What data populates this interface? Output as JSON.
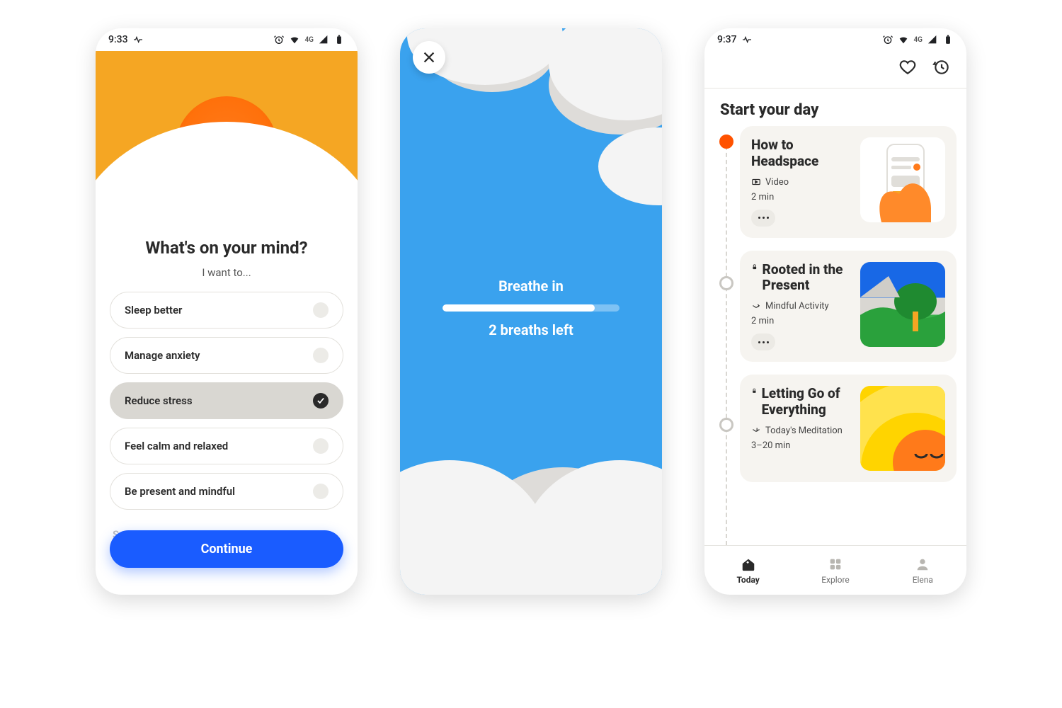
{
  "colors": {
    "accent_orange": "#f5a623",
    "face_orange": "#ff6a00",
    "primary_blue": "#1a5cff",
    "sky_blue": "#3aa2ee",
    "active_red": "#ff5200"
  },
  "screen1": {
    "status": {
      "time": "9:33",
      "network_label": "4G"
    },
    "title": "What's on your mind?",
    "subtitle": "I want to...",
    "options": [
      {
        "label": "Sleep better",
        "selected": false
      },
      {
        "label": "Manage anxiety",
        "selected": false
      },
      {
        "label": "Reduce stress",
        "selected": true
      },
      {
        "label": "Feel calm and relaxed",
        "selected": false
      },
      {
        "label": "Be present and mindful",
        "selected": false
      },
      {
        "label": "Something else",
        "selected": false
      }
    ],
    "cta": "Continue"
  },
  "screen2": {
    "close_icon": "close-icon",
    "instruction": "Breathe in",
    "progress_pct": 86,
    "remaining": "2 breaths left"
  },
  "screen3": {
    "status": {
      "time": "9:37",
      "network_label": "4G"
    },
    "top_actions": {
      "favorite_icon": "heart-icon",
      "history_icon": "history-icon"
    },
    "heading": "Start your day",
    "cards": [
      {
        "title": "How to Headspace",
        "locked": false,
        "type_icon": "video-icon",
        "type": "Video",
        "duration": "2 min",
        "active": true
      },
      {
        "title": "Rooted in the Present",
        "locked": true,
        "type_icon": "activity-icon",
        "type": "Mindful Activity",
        "duration": "2 min",
        "active": false
      },
      {
        "title": "Letting Go of Everything",
        "locked": true,
        "type_icon": "meditation-icon",
        "type": "Today's Meditation",
        "duration": "3–20 min",
        "active": false
      }
    ],
    "tabs": [
      {
        "label": "Today",
        "icon": "home-icon",
        "active": true
      },
      {
        "label": "Explore",
        "icon": "grid-icon",
        "active": false
      },
      {
        "label": "Elena",
        "icon": "user-icon",
        "active": false
      }
    ]
  }
}
